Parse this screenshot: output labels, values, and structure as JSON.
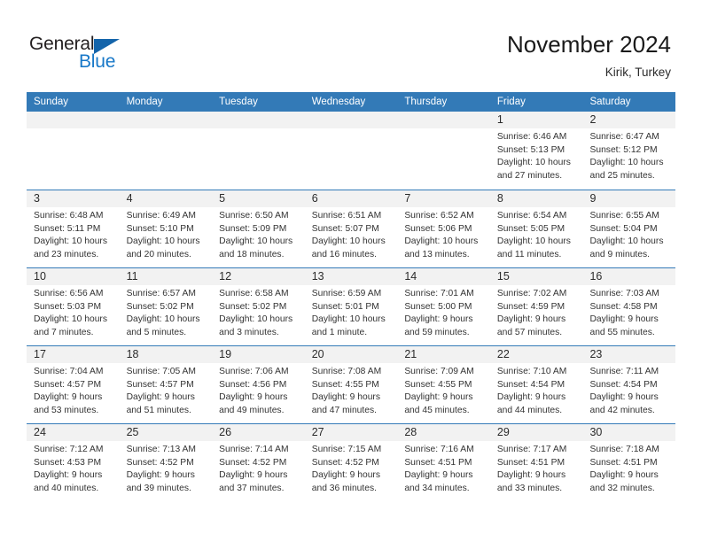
{
  "brand": {
    "name_part1": "General",
    "name_part2": "Blue",
    "color_dark": "#231f20",
    "color_blue": "#1878c8"
  },
  "header": {
    "title": "November 2024",
    "subtitle": "Kirik, Turkey"
  },
  "theme": {
    "header_bg": "#337ab7",
    "day_band_bg": "#f2f2f2",
    "row_divider": "#337ab7"
  },
  "weekdays": [
    "Sunday",
    "Monday",
    "Tuesday",
    "Wednesday",
    "Thursday",
    "Friday",
    "Saturday"
  ],
  "weeks": [
    [
      {
        "day": "",
        "sunrise": "",
        "sunset": "",
        "daylight1": "",
        "daylight2": "",
        "empty": true
      },
      {
        "day": "",
        "sunrise": "",
        "sunset": "",
        "daylight1": "",
        "daylight2": "",
        "empty": true
      },
      {
        "day": "",
        "sunrise": "",
        "sunset": "",
        "daylight1": "",
        "daylight2": "",
        "empty": true
      },
      {
        "day": "",
        "sunrise": "",
        "sunset": "",
        "daylight1": "",
        "daylight2": "",
        "empty": true
      },
      {
        "day": "",
        "sunrise": "",
        "sunset": "",
        "daylight1": "",
        "daylight2": "",
        "empty": true
      },
      {
        "day": "1",
        "sunrise": "Sunrise: 6:46 AM",
        "sunset": "Sunset: 5:13 PM",
        "daylight1": "Daylight: 10 hours",
        "daylight2": "and 27 minutes.",
        "empty": false
      },
      {
        "day": "2",
        "sunrise": "Sunrise: 6:47 AM",
        "sunset": "Sunset: 5:12 PM",
        "daylight1": "Daylight: 10 hours",
        "daylight2": "and 25 minutes.",
        "empty": false
      }
    ],
    [
      {
        "day": "3",
        "sunrise": "Sunrise: 6:48 AM",
        "sunset": "Sunset: 5:11 PM",
        "daylight1": "Daylight: 10 hours",
        "daylight2": "and 23 minutes.",
        "empty": false
      },
      {
        "day": "4",
        "sunrise": "Sunrise: 6:49 AM",
        "sunset": "Sunset: 5:10 PM",
        "daylight1": "Daylight: 10 hours",
        "daylight2": "and 20 minutes.",
        "empty": false
      },
      {
        "day": "5",
        "sunrise": "Sunrise: 6:50 AM",
        "sunset": "Sunset: 5:09 PM",
        "daylight1": "Daylight: 10 hours",
        "daylight2": "and 18 minutes.",
        "empty": false
      },
      {
        "day": "6",
        "sunrise": "Sunrise: 6:51 AM",
        "sunset": "Sunset: 5:07 PM",
        "daylight1": "Daylight: 10 hours",
        "daylight2": "and 16 minutes.",
        "empty": false
      },
      {
        "day": "7",
        "sunrise": "Sunrise: 6:52 AM",
        "sunset": "Sunset: 5:06 PM",
        "daylight1": "Daylight: 10 hours",
        "daylight2": "and 13 minutes.",
        "empty": false
      },
      {
        "day": "8",
        "sunrise": "Sunrise: 6:54 AM",
        "sunset": "Sunset: 5:05 PM",
        "daylight1": "Daylight: 10 hours",
        "daylight2": "and 11 minutes.",
        "empty": false
      },
      {
        "day": "9",
        "sunrise": "Sunrise: 6:55 AM",
        "sunset": "Sunset: 5:04 PM",
        "daylight1": "Daylight: 10 hours",
        "daylight2": "and 9 minutes.",
        "empty": false
      }
    ],
    [
      {
        "day": "10",
        "sunrise": "Sunrise: 6:56 AM",
        "sunset": "Sunset: 5:03 PM",
        "daylight1": "Daylight: 10 hours",
        "daylight2": "and 7 minutes.",
        "empty": false
      },
      {
        "day": "11",
        "sunrise": "Sunrise: 6:57 AM",
        "sunset": "Sunset: 5:02 PM",
        "daylight1": "Daylight: 10 hours",
        "daylight2": "and 5 minutes.",
        "empty": false
      },
      {
        "day": "12",
        "sunrise": "Sunrise: 6:58 AM",
        "sunset": "Sunset: 5:02 PM",
        "daylight1": "Daylight: 10 hours",
        "daylight2": "and 3 minutes.",
        "empty": false
      },
      {
        "day": "13",
        "sunrise": "Sunrise: 6:59 AM",
        "sunset": "Sunset: 5:01 PM",
        "daylight1": "Daylight: 10 hours",
        "daylight2": "and 1 minute.",
        "empty": false
      },
      {
        "day": "14",
        "sunrise": "Sunrise: 7:01 AM",
        "sunset": "Sunset: 5:00 PM",
        "daylight1": "Daylight: 9 hours",
        "daylight2": "and 59 minutes.",
        "empty": false
      },
      {
        "day": "15",
        "sunrise": "Sunrise: 7:02 AM",
        "sunset": "Sunset: 4:59 PM",
        "daylight1": "Daylight: 9 hours",
        "daylight2": "and 57 minutes.",
        "empty": false
      },
      {
        "day": "16",
        "sunrise": "Sunrise: 7:03 AM",
        "sunset": "Sunset: 4:58 PM",
        "daylight1": "Daylight: 9 hours",
        "daylight2": "and 55 minutes.",
        "empty": false
      }
    ],
    [
      {
        "day": "17",
        "sunrise": "Sunrise: 7:04 AM",
        "sunset": "Sunset: 4:57 PM",
        "daylight1": "Daylight: 9 hours",
        "daylight2": "and 53 minutes.",
        "empty": false
      },
      {
        "day": "18",
        "sunrise": "Sunrise: 7:05 AM",
        "sunset": "Sunset: 4:57 PM",
        "daylight1": "Daylight: 9 hours",
        "daylight2": "and 51 minutes.",
        "empty": false
      },
      {
        "day": "19",
        "sunrise": "Sunrise: 7:06 AM",
        "sunset": "Sunset: 4:56 PM",
        "daylight1": "Daylight: 9 hours",
        "daylight2": "and 49 minutes.",
        "empty": false
      },
      {
        "day": "20",
        "sunrise": "Sunrise: 7:08 AM",
        "sunset": "Sunset: 4:55 PM",
        "daylight1": "Daylight: 9 hours",
        "daylight2": "and 47 minutes.",
        "empty": false
      },
      {
        "day": "21",
        "sunrise": "Sunrise: 7:09 AM",
        "sunset": "Sunset: 4:55 PM",
        "daylight1": "Daylight: 9 hours",
        "daylight2": "and 45 minutes.",
        "empty": false
      },
      {
        "day": "22",
        "sunrise": "Sunrise: 7:10 AM",
        "sunset": "Sunset: 4:54 PM",
        "daylight1": "Daylight: 9 hours",
        "daylight2": "and 44 minutes.",
        "empty": false
      },
      {
        "day": "23",
        "sunrise": "Sunrise: 7:11 AM",
        "sunset": "Sunset: 4:54 PM",
        "daylight1": "Daylight: 9 hours",
        "daylight2": "and 42 minutes.",
        "empty": false
      }
    ],
    [
      {
        "day": "24",
        "sunrise": "Sunrise: 7:12 AM",
        "sunset": "Sunset: 4:53 PM",
        "daylight1": "Daylight: 9 hours",
        "daylight2": "and 40 minutes.",
        "empty": false
      },
      {
        "day": "25",
        "sunrise": "Sunrise: 7:13 AM",
        "sunset": "Sunset: 4:52 PM",
        "daylight1": "Daylight: 9 hours",
        "daylight2": "and 39 minutes.",
        "empty": false
      },
      {
        "day": "26",
        "sunrise": "Sunrise: 7:14 AM",
        "sunset": "Sunset: 4:52 PM",
        "daylight1": "Daylight: 9 hours",
        "daylight2": "and 37 minutes.",
        "empty": false
      },
      {
        "day": "27",
        "sunrise": "Sunrise: 7:15 AM",
        "sunset": "Sunset: 4:52 PM",
        "daylight1": "Daylight: 9 hours",
        "daylight2": "and 36 minutes.",
        "empty": false
      },
      {
        "day": "28",
        "sunrise": "Sunrise: 7:16 AM",
        "sunset": "Sunset: 4:51 PM",
        "daylight1": "Daylight: 9 hours",
        "daylight2": "and 34 minutes.",
        "empty": false
      },
      {
        "day": "29",
        "sunrise": "Sunrise: 7:17 AM",
        "sunset": "Sunset: 4:51 PM",
        "daylight1": "Daylight: 9 hours",
        "daylight2": "and 33 minutes.",
        "empty": false
      },
      {
        "day": "30",
        "sunrise": "Sunrise: 7:18 AM",
        "sunset": "Sunset: 4:51 PM",
        "daylight1": "Daylight: 9 hours",
        "daylight2": "and 32 minutes.",
        "empty": false
      }
    ]
  ]
}
